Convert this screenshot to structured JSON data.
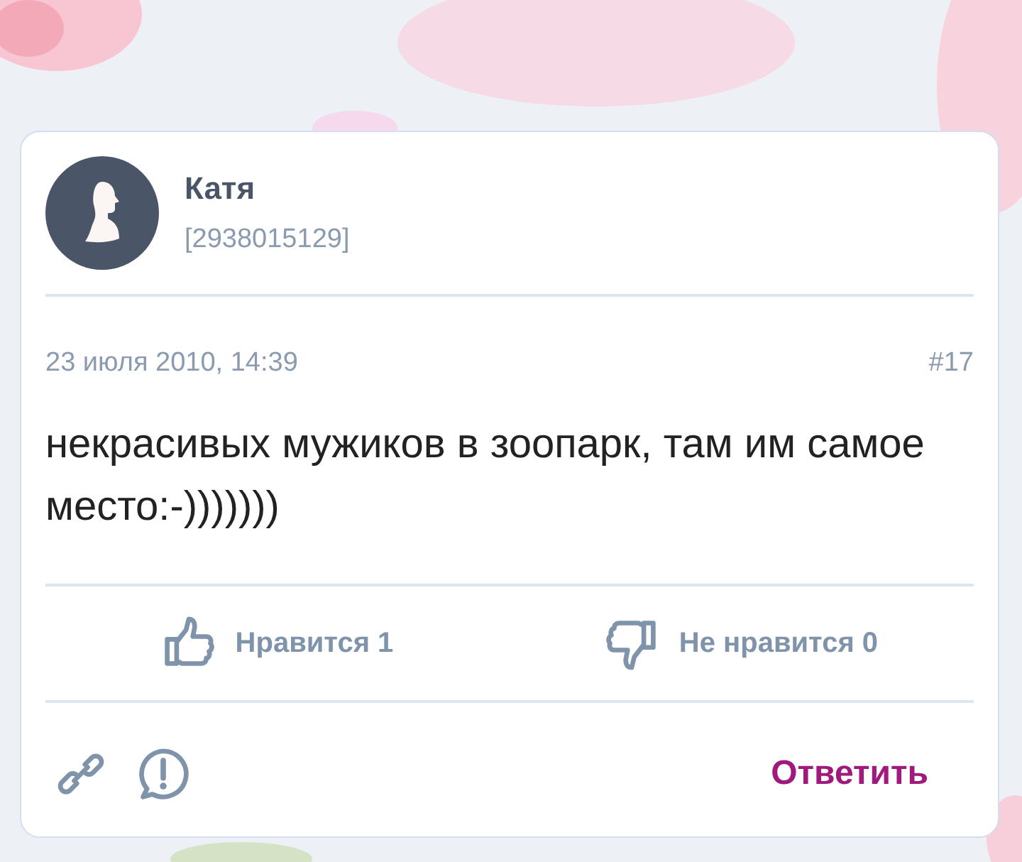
{
  "author": {
    "name": "Катя",
    "id": "[2938015129]"
  },
  "post": {
    "date": "23 июля 2010, 14:39",
    "number": "#17",
    "text": "некрасивых мужиков в зоопарк, там им самое место:-)))))))"
  },
  "reactions": [
    {
      "kind": "like",
      "label": "Нравится 1"
    },
    {
      "kind": "dislike",
      "label": "Не нравится 0"
    }
  ],
  "reply_button": "Ответить"
}
